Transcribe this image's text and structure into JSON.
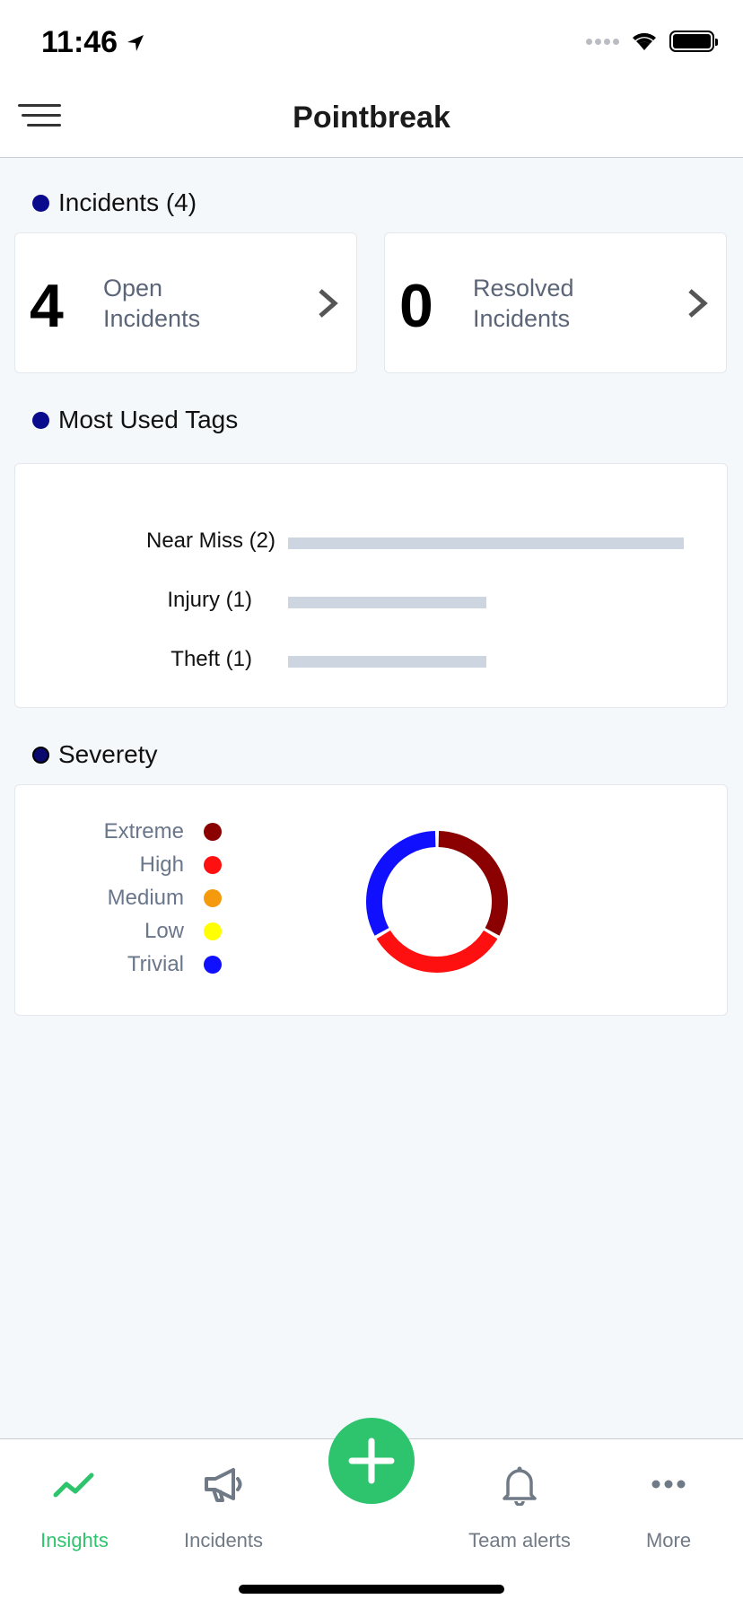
{
  "status_bar": {
    "time": "11:46"
  },
  "header": {
    "title": "Pointbreak"
  },
  "incidents": {
    "heading": "Incidents (4)",
    "open": {
      "count": "4",
      "label": "Open Incidents"
    },
    "resolved": {
      "count": "0",
      "label": "Resolved Incidents"
    }
  },
  "tags": {
    "heading": "Most Used Tags"
  },
  "severity": {
    "heading": "Severety",
    "legend": [
      {
        "label": "Extreme",
        "color": "#8b0000"
      },
      {
        "label": "High",
        "color": "#ff1010"
      },
      {
        "label": "Medium",
        "color": "#f59a0c"
      },
      {
        "label": "Low",
        "color": "#ffff00"
      },
      {
        "label": "Trivial",
        "color": "#1010ff"
      }
    ]
  },
  "chart_data": [
    {
      "type": "bar",
      "orientation": "horizontal",
      "categories": [
        "Near Miss (2)",
        "Injury (1)",
        "Theft (1)"
      ],
      "values": [
        2,
        1,
        1
      ],
      "bar_color": "#cdd6e0",
      "title": "Most Used Tags"
    },
    {
      "type": "pie",
      "style": "donut",
      "title": "Severety",
      "labels": [
        "Extreme",
        "High",
        "Medium",
        "Low",
        "Trivial"
      ],
      "values": [
        1,
        1,
        0,
        0,
        1
      ],
      "colors": [
        "#8b0000",
        "#ff1010",
        "#f59a0c",
        "#ffff00",
        "#1010ff"
      ],
      "legend": "left"
    }
  ],
  "tab_bar": {
    "tabs": [
      {
        "label": "Insights",
        "icon": "insights-icon",
        "active": true
      },
      {
        "label": "Incidents",
        "icon": "megaphone-icon",
        "active": false
      },
      {
        "label": "Team alerts",
        "icon": "bell-icon",
        "active": false
      },
      {
        "label": "More",
        "icon": "more-icon",
        "active": false
      }
    ],
    "active_color": "#2ec46d",
    "fab_icon": "plus-icon"
  }
}
